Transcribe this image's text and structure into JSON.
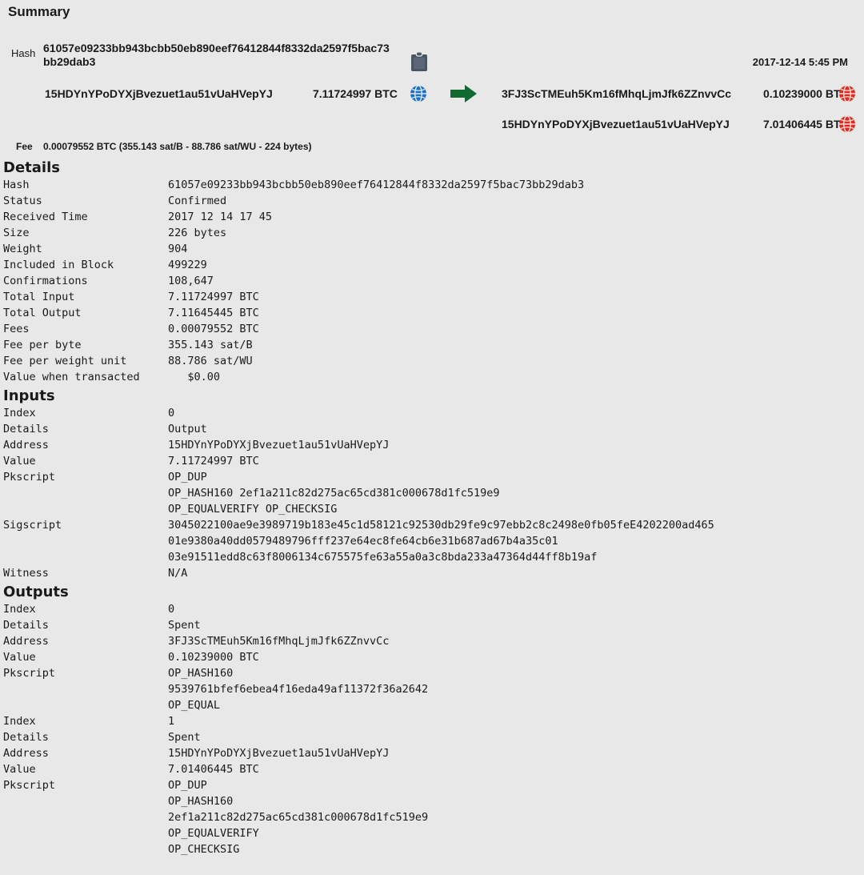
{
  "summary": {
    "title": "Summary",
    "hash_label": "Hash",
    "hash_value": "61057e09233bb943bcbb50eb890eef76412844f8332da2597f5bac73bb29dab3",
    "timestamp": "2017-12-14 5:45 PM",
    "copy_icon": "clipboard-icon",
    "arrow_icon": "green-arrow-icon",
    "input_globe_icon": "blue-globe-icon",
    "output_globe_icon": "red-globe-icon",
    "inputs": [
      {
        "address": "15HDYnYPoDYXjBvezuet1au51vUaHVepYJ",
        "amount": "7.11724997 BTC"
      }
    ],
    "outputs": [
      {
        "address": "3FJ3ScTMEuh5Km16fMhqLjmJfk6ZZnvvCc",
        "amount": "0.10239000 BTC"
      },
      {
        "address": "15HDYnYPoDYXjBvezuet1au51vUaHVepYJ",
        "amount": "7.01406445 BTC"
      }
    ],
    "fee_label": "Fee",
    "fee_value": "0.00079552 BTC (355.143 sat/B - 88.786 sat/WU - 224 bytes)"
  },
  "details": {
    "title": "Details",
    "rows": [
      {
        "key": "Hash",
        "value": "61057e09233bb943bcbb50eb890eef76412844f8332da2597f5bac73bb29dab3"
      },
      {
        "key": "Status",
        "value": "Confirmed"
      },
      {
        "key": "Received Time",
        "value": "2017 12 14 17 45"
      },
      {
        "key": "Size",
        "value": "226 bytes"
      },
      {
        "key": "Weight",
        "value": "904"
      },
      {
        "key": "Included in Block",
        "value": "499229"
      },
      {
        "key": "Confirmations",
        "value": "108,647"
      },
      {
        "key": "Total Input",
        "value": "7.11724997 BTC"
      },
      {
        "key": "Total Output",
        "value": "7.11645445 BTC"
      },
      {
        "key": "Fees",
        "value": "0.00079552 BTC"
      },
      {
        "key": "Fee per byte",
        "value": "355.143 sat/B"
      },
      {
        "key": "Fee per weight unit ",
        "value": "88.786 sat/WU"
      },
      {
        "key": "Value when transacted",
        "value": "   $0.00"
      }
    ]
  },
  "inputs_section": {
    "title": "Inputs",
    "rows": [
      {
        "key": "Index",
        "value": "0"
      },
      {
        "key": "Details",
        "value": "Output"
      },
      {
        "key": "Address",
        "value": "15HDYnYPoDYXjBvezuet1au51vUaHVepYJ"
      },
      {
        "key": "Value",
        "value": "7.11724997 BTC"
      },
      {
        "key": "Pkscript",
        "value": "OP_DUP",
        "continuation": [
          "OP_HASH160 2ef1a211c82d275ac65cd381c000678d1fc519e9",
          "OP_EQUALVERIFY OP_CHECKSIG"
        ]
      },
      {
        "key": "Sigscript",
        "value": "3045022100ae9e3989719b183e45c1d58121c92530db29fe9c97ebb2c8c2498e0fb05feE4202200ad465",
        "continuation": [
          "01e9380a40dd0579489796fff237e64ec8fe64cb6e31b687ad67b4a35c01",
          "03e91511edd8c63f8006134c675575fe63a55a0a3c8bda233a47364d44ff8b19af"
        ]
      },
      {
        "key": "Witness",
        "value": "N/A"
      }
    ]
  },
  "outputs_section": {
    "title": "Outputs",
    "rows": [
      {
        "key": "Index",
        "value": "0"
      },
      {
        "key": "Details",
        "value": "Spent"
      },
      {
        "key": "Address",
        "value": "3FJ3ScTMEuh5Km16fMhqLjmJfk6ZZnvvCc"
      },
      {
        "key": "Value",
        "value": "0.10239000 BTC"
      },
      {
        "key": "Pkscript",
        "value": "OP_HASH160",
        "continuation": [
          "9539761bfef6ebea4f16eda49af11372f36a2642",
          "OP_EQUAL"
        ]
      },
      {
        "key": "Index",
        "value": "1"
      },
      {
        "key": "Details",
        "value": "Spent"
      },
      {
        "key": "Address",
        "value": "15HDYnYPoDYXjBvezuet1au51vUaHVepYJ"
      },
      {
        "key": "Value",
        "value": "7.01406445 BTC"
      },
      {
        "key": "Pkscript",
        "value": "OP_DUP",
        "continuation": [
          "OP_HASH160",
          "2ef1a211c82d275ac65cd381c000678d1fc519e9",
          "OP_EQUALVERIFY",
          "OP_CHECKSIG"
        ]
      }
    ]
  },
  "colors": {
    "background": "#e8e8e8",
    "text": "#1a1a1a",
    "clipboard": "#4a5568",
    "blue_globe": "#1b6fc4",
    "red_globe": "#e02b20",
    "green_arrow": "#0f6a2f"
  }
}
